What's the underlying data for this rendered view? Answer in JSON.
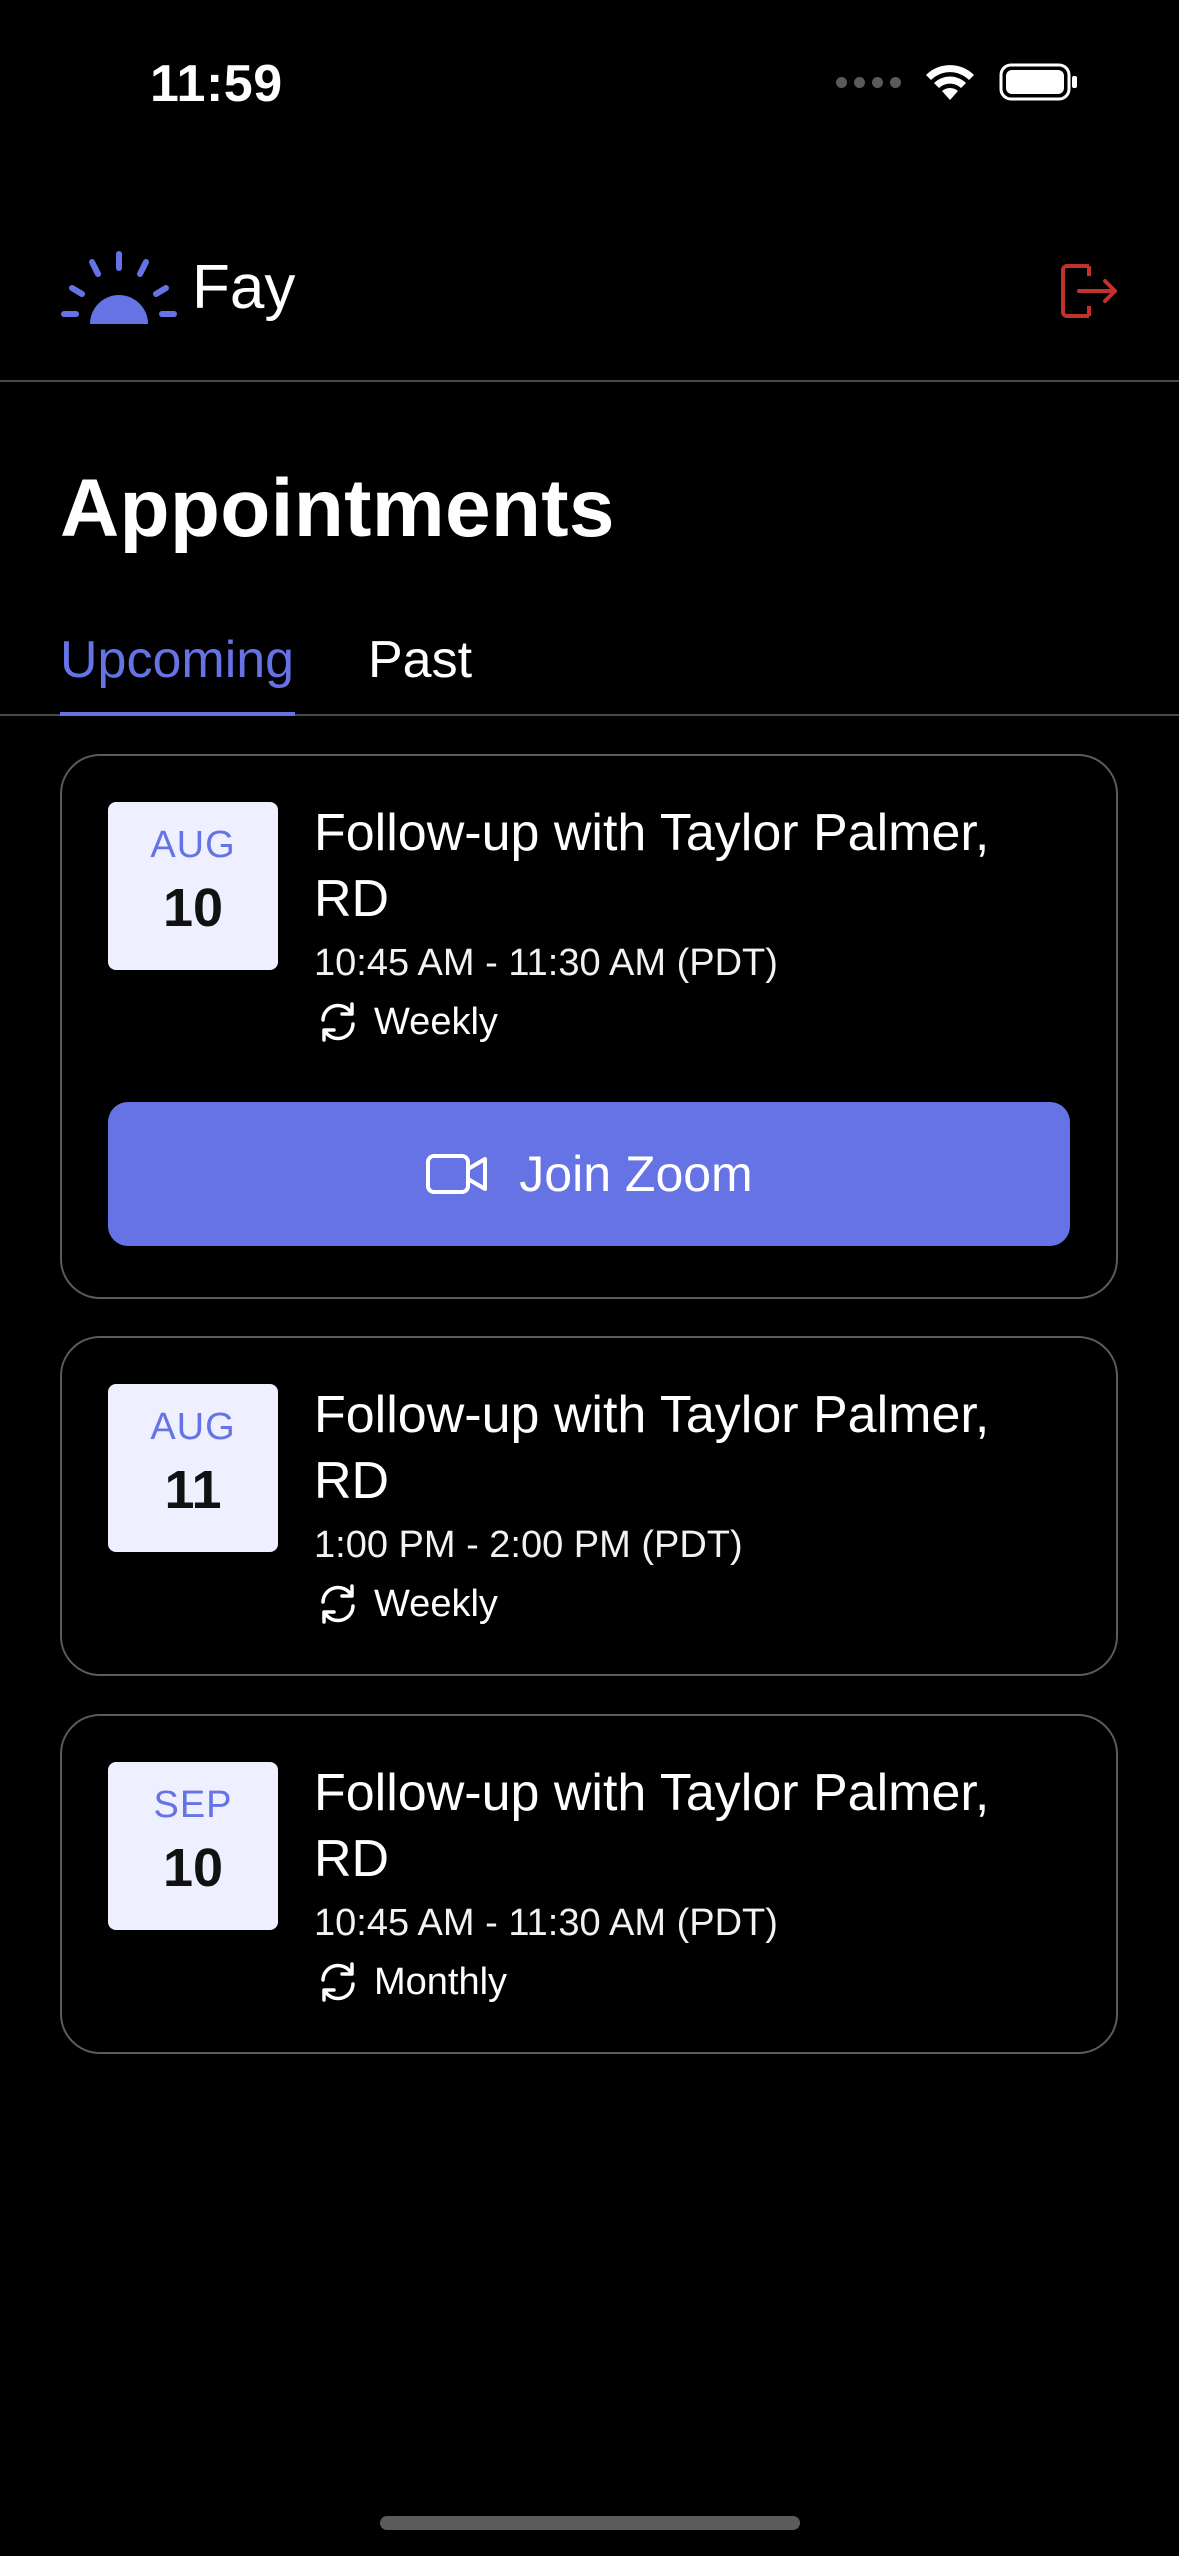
{
  "status_bar": {
    "time": "11:59"
  },
  "header": {
    "app_name": "Fay",
    "logo_icon": "sun-logo-icon",
    "logout_icon": "logout-icon",
    "accent_color": "#6673e5",
    "logout_color": "#c0322b"
  },
  "page": {
    "title": "Appointments"
  },
  "tabs": [
    {
      "label": "Upcoming",
      "active": true
    },
    {
      "label": "Past",
      "active": false
    }
  ],
  "appointments": [
    {
      "month": "AUG",
      "day": "10",
      "title": "Follow-up with Taylor Palmer, RD",
      "time": "10:45 AM - 11:30 AM (PDT)",
      "recurrence": "Weekly",
      "join_label": "Join Zoom"
    },
    {
      "month": "AUG",
      "day": "11",
      "title": "Follow-up with Taylor Palmer, RD",
      "time": "1:00 PM - 2:00 PM (PDT)",
      "recurrence": "Weekly"
    },
    {
      "month": "SEP",
      "day": "10",
      "title": "Follow-up with Taylor Palmer, RD",
      "time": "10:45 AM - 11:30 AM (PDT)",
      "recurrence": "Monthly"
    }
  ]
}
